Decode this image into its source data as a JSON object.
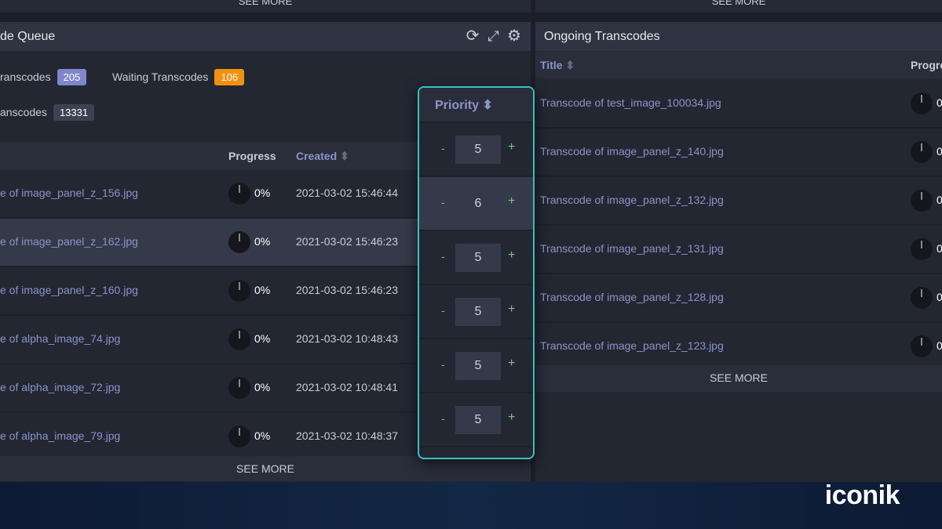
{
  "top": {
    "see_more_left": "SEE MORE",
    "see_more_right": "SEE MORE"
  },
  "queue": {
    "title": "de Queue",
    "stats": [
      {
        "label": "ranscodes",
        "value": "205",
        "color": "#7f86c9"
      },
      {
        "label": "Waiting Transcodes",
        "value": "106",
        "color": "#f29111"
      },
      {
        "label": "anscodes",
        "value": "13331",
        "color": "#3d4253"
      }
    ],
    "columns": {
      "progress": "Progress",
      "created": "Created"
    },
    "rows": [
      {
        "title": "e of image_panel_z_156.jpg",
        "progress": "0%",
        "created": "2021-03-02 15:46:44"
      },
      {
        "title": "e of image_panel_z_162.jpg",
        "progress": "0%",
        "created": "2021-03-02 15:46:23"
      },
      {
        "title": "e of image_panel_z_160.jpg",
        "progress": "0%",
        "created": "2021-03-02 15:46:23"
      },
      {
        "title": "e of alpha_image_74.jpg",
        "progress": "0%",
        "created": "2021-03-02 10:48:43"
      },
      {
        "title": "e of alpha_image_72.jpg",
        "progress": "0%",
        "created": "2021-03-02 10:48:41"
      },
      {
        "title": "e of alpha_image_79.jpg",
        "progress": "0%",
        "created": "2021-03-02 10:48:37"
      }
    ],
    "see_more": "SEE MORE"
  },
  "priority": {
    "header": "Priority",
    "values": [
      "5",
      "6",
      "5",
      "5",
      "5",
      "5"
    ],
    "minus": "-",
    "plus": "+"
  },
  "ongoing": {
    "title": "Ongoing Transcodes",
    "columns": {
      "title": "Title",
      "progress": "Progre"
    },
    "rows": [
      {
        "title": "Transcode of test_image_100034.jpg",
        "progress": "0"
      },
      {
        "title": "Transcode of image_panel_z_140.jpg",
        "progress": "0"
      },
      {
        "title": "Transcode of image_panel_z_132.jpg",
        "progress": "0"
      },
      {
        "title": "Transcode of image_panel_z_131.jpg",
        "progress": "0"
      },
      {
        "title": "Transcode of image_panel_z_128.jpg",
        "progress": "0"
      },
      {
        "title": "Transcode of image_panel_z_123.jpg",
        "progress": "0"
      }
    ],
    "see_more": "SEE MORE"
  },
  "brand": {
    "logo": "iconik"
  }
}
